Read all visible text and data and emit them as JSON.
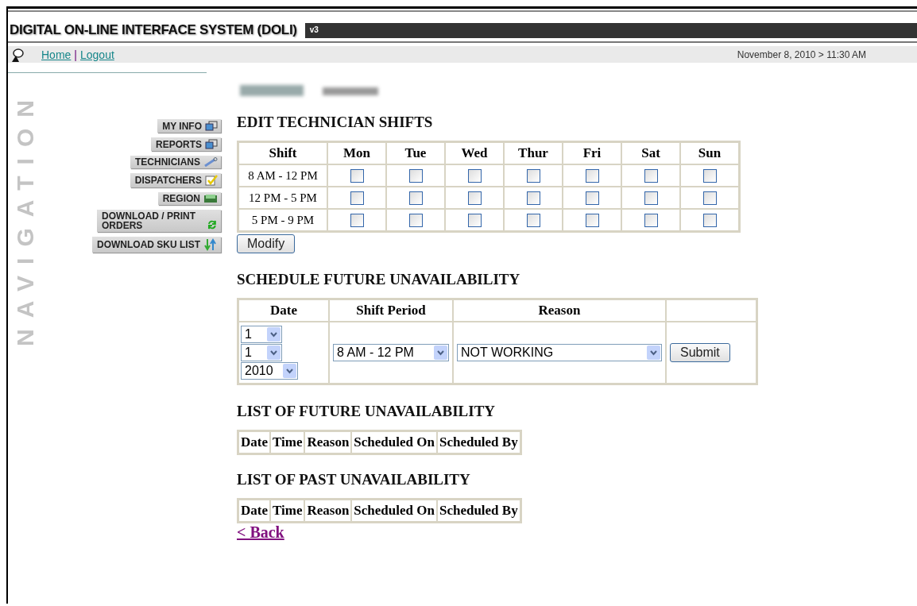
{
  "header": {
    "title": "DIGITAL ON-LINE INTERFACE SYSTEM (DOLI)",
    "version": "v3"
  },
  "topbar": {
    "links": [
      "Home",
      "Logout"
    ],
    "separator": "|",
    "datetime": "November 8, 2010 > 11:30 AM"
  },
  "navigation": {
    "label": "NAVIGATION",
    "items": [
      "MY INFO",
      "REPORTS",
      "TECHNICIANS",
      "DISPATCHERS",
      "REGION",
      "DOWNLOAD / PRINT ORDERS",
      "DOWNLOAD SKU LIST"
    ]
  },
  "shifts": {
    "title": "EDIT TECHNICIAN SHIFTS",
    "columns": [
      "Shift",
      "Mon",
      "Tue",
      "Wed",
      "Thur",
      "Fri",
      "Sat",
      "Sun"
    ],
    "rows": [
      {
        "label": "8 AM - 12 PM",
        "days": [
          {
            "checked": false
          },
          {
            "checked": false
          },
          {
            "checked": false
          },
          {
            "checked": false
          },
          {
            "checked": false
          },
          {
            "checked": false
          },
          {
            "checked": false
          }
        ]
      },
      {
        "label": "12 PM - 5 PM",
        "days": [
          {
            "checked": false
          },
          {
            "checked": false
          },
          {
            "checked": false
          },
          {
            "checked": false
          },
          {
            "checked": false
          },
          {
            "checked": false
          },
          {
            "checked": false
          }
        ]
      },
      {
        "label": "5 PM - 9 PM",
        "days": [
          {
            "checked": false
          },
          {
            "checked": false
          },
          {
            "checked": false
          },
          {
            "checked": false
          },
          {
            "checked": false
          },
          {
            "checked": false
          },
          {
            "checked": false
          }
        ]
      }
    ],
    "button": "Modify"
  },
  "schedule": {
    "title": "SCHEDULE FUTURE UNAVAILABILITY",
    "columns": [
      "Date",
      "Shift Period",
      "Reason"
    ],
    "date": [
      "1",
      "1",
      "2010"
    ],
    "shift_period": "8 AM - 12 PM",
    "reason": "NOT WORKING",
    "button": "Submit"
  },
  "future_list": {
    "title": "LIST OF FUTURE UNAVAILABILITY",
    "columns": [
      "Date",
      "Time",
      "Reason",
      "Scheduled On",
      "Scheduled By"
    ]
  },
  "past_list": {
    "title": "LIST OF PAST UNAVAILABILITY",
    "columns": [
      "Date",
      "Time",
      "Reason",
      "Scheduled On",
      "Scheduled By"
    ]
  },
  "back_link": "< Back"
}
